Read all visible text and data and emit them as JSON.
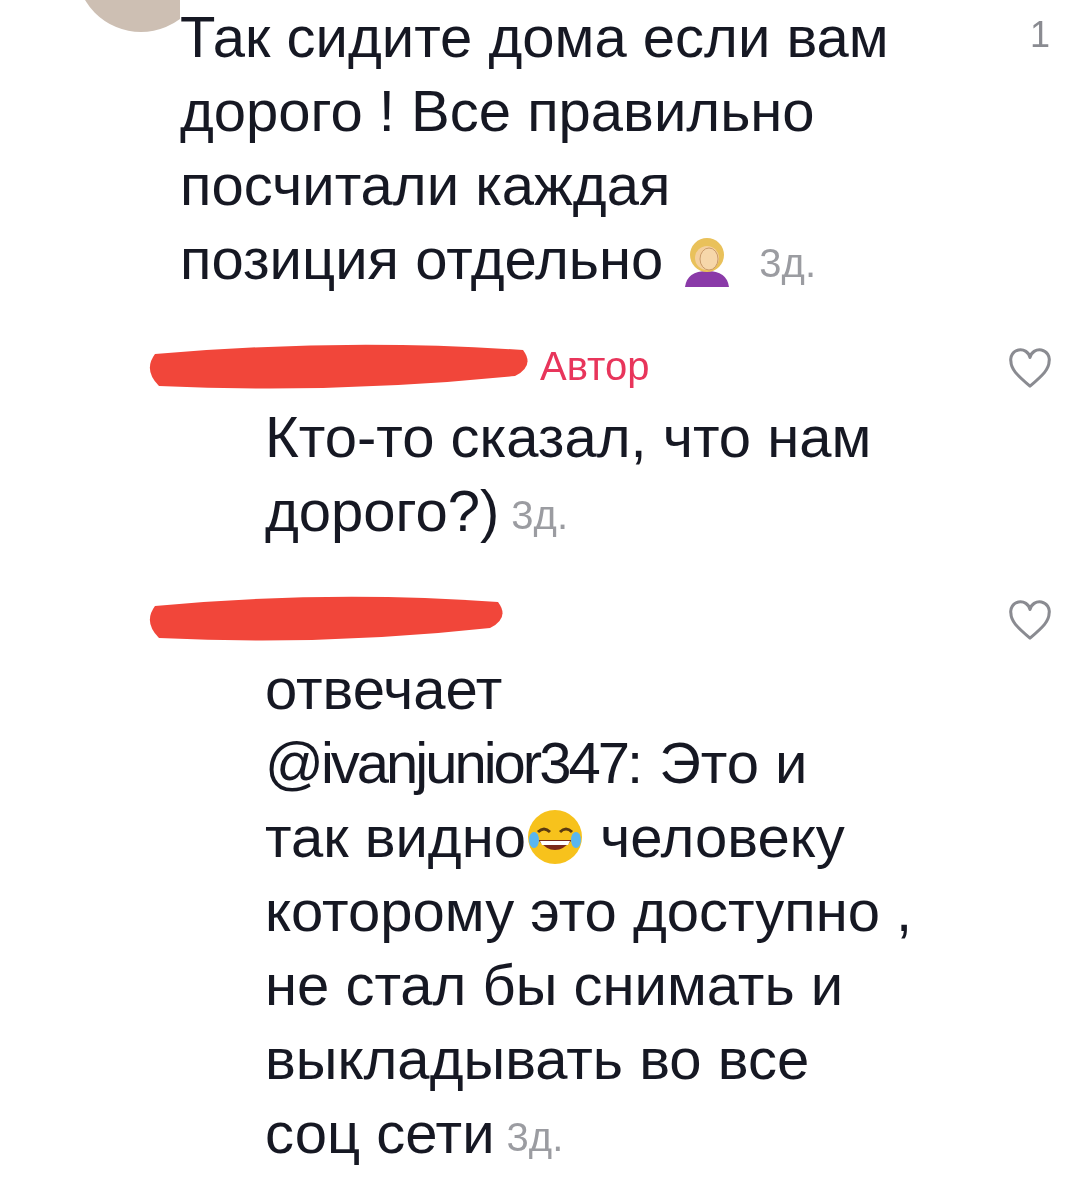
{
  "comments": [
    {
      "kind": "top",
      "like_count": "1",
      "lines": [
        [
          {
            "kind": "text",
            "text": "Так сидите дома если вам"
          }
        ],
        [
          {
            "kind": "text",
            "text": "дорого ! Все правильно"
          }
        ],
        [
          {
            "kind": "text",
            "text": "посчитали каждая"
          }
        ],
        [
          {
            "kind": "text",
            "text": "позиция отдельно"
          },
          {
            "kind": "facepalm_emoji"
          },
          {
            "kind": "time",
            "text": "3д."
          }
        ]
      ]
    },
    {
      "kind": "reply",
      "badge": "Автор",
      "liked": false,
      "lines": [
        [
          {
            "kind": "text",
            "text": "Кто-то сказал, что нам"
          }
        ],
        [
          {
            "kind": "text",
            "text": "дорого?)"
          },
          {
            "kind": "time",
            "text": "3д."
          }
        ]
      ]
    },
    {
      "kind": "reply",
      "liked": false,
      "lines": [
        [
          {
            "kind": "text",
            "text": "отвечает"
          }
        ],
        [
          {
            "kind": "mention",
            "text": "@ivanjunior347"
          },
          {
            "kind": "text",
            "text": ": Это и"
          }
        ],
        [
          {
            "kind": "text",
            "text": "так видно"
          },
          {
            "kind": "laughing_emoji"
          },
          {
            "kind": "text",
            "text": "человеку"
          }
        ],
        [
          {
            "kind": "text",
            "text": "которому это доступно ,"
          }
        ],
        [
          {
            "kind": "text",
            "text": "не стал бы снимать и"
          }
        ],
        [
          {
            "kind": "text",
            "text": "выкладывать во все"
          }
        ],
        [
          {
            "kind": "text",
            "text": "соц сети"
          },
          {
            "kind": "time",
            "text": "3д."
          }
        ]
      ]
    }
  ]
}
